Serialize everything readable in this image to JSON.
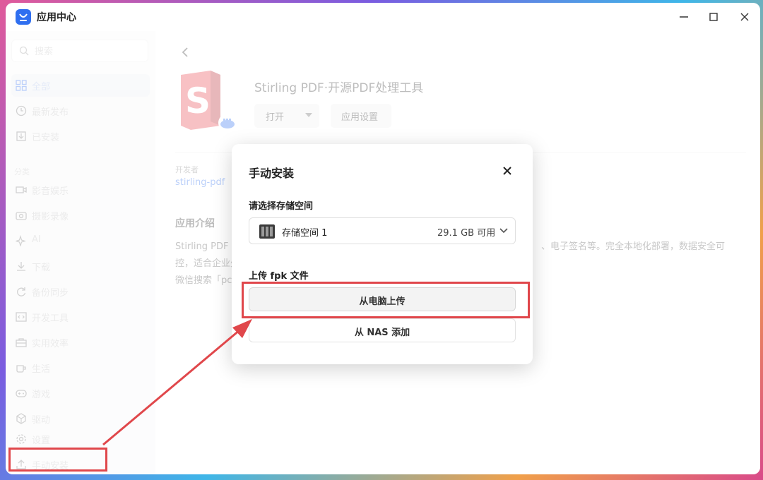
{
  "window": {
    "title": "应用中心",
    "logo_icon": "app-center-bag-icon",
    "controls": [
      "minimize-icon",
      "maximize-icon",
      "close-icon"
    ]
  },
  "sidebar": {
    "search_placeholder": "搜索",
    "items_top": [
      {
        "label": "全部",
        "icon": "grid-icon",
        "active": true
      },
      {
        "label": "最新发布",
        "icon": "clock-icon"
      },
      {
        "label": "已安装",
        "icon": "installed-box-icon"
      }
    ],
    "section_label": "分类",
    "categories": [
      {
        "label": "影音娱乐",
        "icon": "video-icon"
      },
      {
        "label": "摄影录像",
        "icon": "camera-icon"
      },
      {
        "label": "AI",
        "icon": "sparkle-icon"
      },
      {
        "label": "下载",
        "icon": "download-icon"
      },
      {
        "label": "备份同步",
        "icon": "sync-icon"
      },
      {
        "label": "开发工具",
        "icon": "code-icon"
      },
      {
        "label": "实用效率",
        "icon": "toolbox-icon"
      },
      {
        "label": "生活",
        "icon": "cup-icon"
      },
      {
        "label": "游戏",
        "icon": "gamepad-icon"
      },
      {
        "label": "驱动",
        "icon": "driver-icon"
      }
    ],
    "settings_label": "设置",
    "manual_install_label": "手动安装"
  },
  "app_detail": {
    "name": "Stirling PDF·开源PDF处理工具",
    "open_label": "打开",
    "settings_label": "应用设置",
    "developer_label": "开发者",
    "developer_name": "stirling-pdf",
    "intro_title": "应用介绍",
    "intro_lines": [
      "Stirling PDF 提",
      "控，适合企业处",
      "微信搜索「pcy"
    ],
    "intro_right_fragment": "、电子签名等。完全本地化部署，数据安全可"
  },
  "dialog": {
    "title": "手动安装",
    "storage_label": "请选择存储空间",
    "storage_name": "存储空间 1",
    "storage_free": "29.1 GB 可用",
    "upload_label": "上传 fpk 文件",
    "upload_pc_label": "从电脑上传",
    "add_nas_label": "从 NAS 添加"
  },
  "colors": {
    "accent": "#2f6ff0",
    "highlight": "#e0474b"
  }
}
